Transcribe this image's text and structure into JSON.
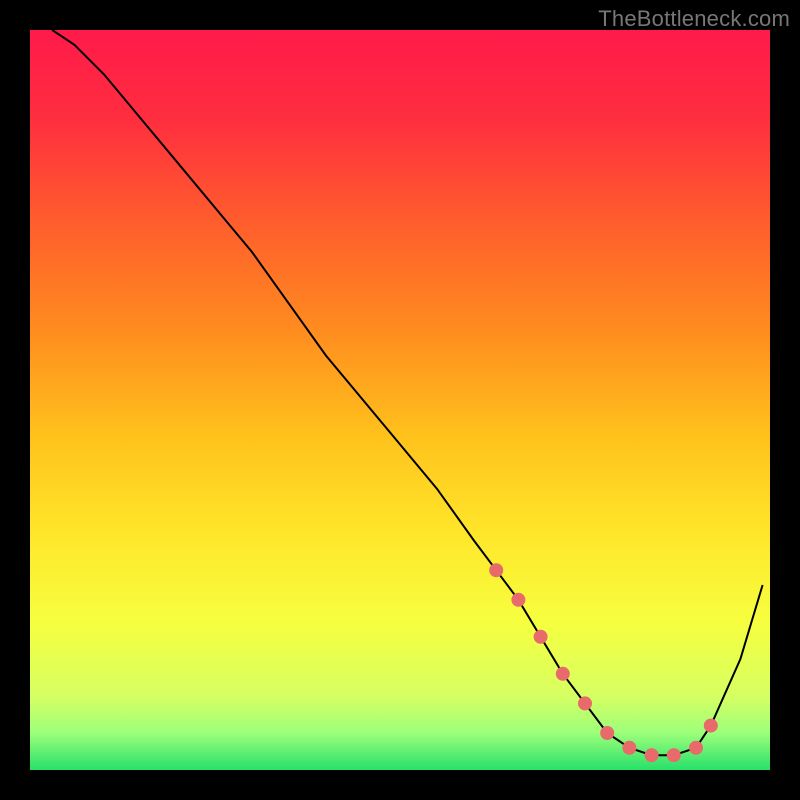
{
  "attribution": "TheBottleneck.com",
  "chart_data": {
    "type": "line",
    "title": "",
    "xlabel": "",
    "ylabel": "",
    "xlim": [
      0,
      100
    ],
    "ylim": [
      0,
      100
    ],
    "x": [
      3,
      6,
      10,
      15,
      20,
      25,
      30,
      35,
      40,
      45,
      50,
      55,
      60,
      63,
      66,
      69,
      72,
      75,
      78,
      81,
      84,
      87,
      90,
      92,
      96,
      99
    ],
    "values": [
      100,
      98,
      94,
      88,
      82,
      76,
      70,
      63,
      56,
      50,
      44,
      38,
      31,
      27,
      23,
      18,
      13,
      9,
      5,
      3,
      2,
      2,
      3,
      6,
      15,
      25
    ],
    "marker_index_range": [
      13,
      23
    ],
    "gradient_stops": [
      {
        "offset": 0.0,
        "color": "#ff1a4a"
      },
      {
        "offset": 0.12,
        "color": "#ff2e3f"
      },
      {
        "offset": 0.25,
        "color": "#ff5a2e"
      },
      {
        "offset": 0.4,
        "color": "#ff8a1f"
      },
      {
        "offset": 0.55,
        "color": "#ffc21c"
      },
      {
        "offset": 0.68,
        "color": "#ffe62a"
      },
      {
        "offset": 0.8,
        "color": "#f6ff3f"
      },
      {
        "offset": 0.9,
        "color": "#d6ff62"
      },
      {
        "offset": 0.95,
        "color": "#9cff7a"
      },
      {
        "offset": 1.0,
        "color": "#27e06b"
      }
    ],
    "plot_bg": "#000000",
    "line_color": "#000000",
    "marker_color": "#e86a6a"
  }
}
